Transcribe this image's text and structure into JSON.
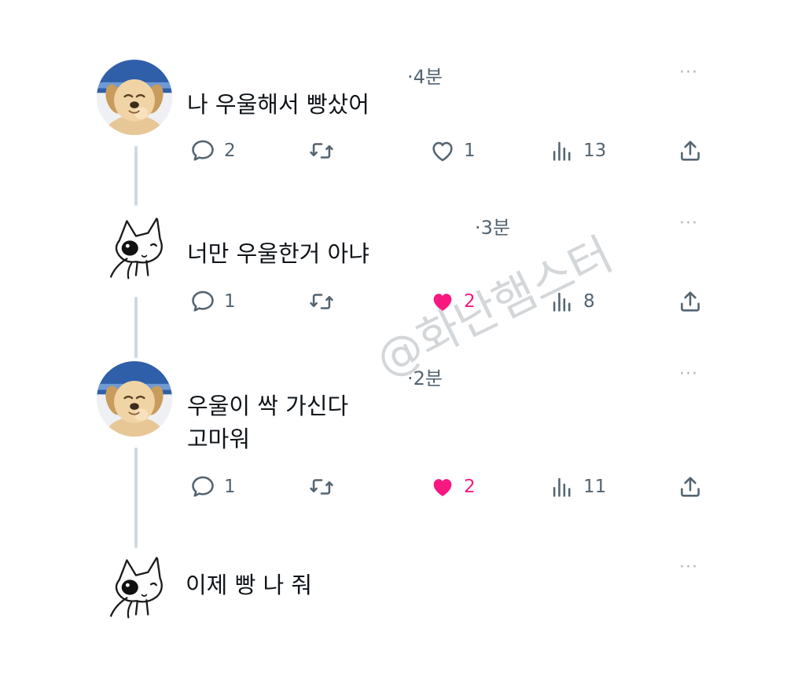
{
  "posts": [
    {
      "avatar": "puppy-avatar",
      "time": "·4분",
      "text": "나 우울해서 빵샀어",
      "actions": {
        "replies": "2",
        "retweets": "",
        "likes": "1",
        "liked": false,
        "views": "13"
      }
    },
    {
      "avatar": "cat-avatar",
      "time": "·3분",
      "text": "너만 우울한거 아냐",
      "actions": {
        "replies": "1",
        "retweets": "",
        "likes": "2",
        "liked": true,
        "views": "8"
      }
    },
    {
      "avatar": "puppy-avatar",
      "time": "·2분",
      "text": "우울이 싹 가신다\n고마워",
      "actions": {
        "replies": "1",
        "retweets": "",
        "likes": "2",
        "liked": true,
        "views": "11"
      }
    },
    {
      "avatar": "cat-avatar",
      "time": "",
      "text": "이제 빵 나 줘"
    }
  ],
  "more_label": "···",
  "watermark": "@화난햄스터",
  "colors": {
    "like_active": "#f91880",
    "icon_gray": "#536471",
    "connector": "#cfd9de"
  },
  "icons": [
    "reply-icon",
    "retweet-icon",
    "like-icon",
    "views-icon",
    "share-icon",
    "more-icon"
  ]
}
